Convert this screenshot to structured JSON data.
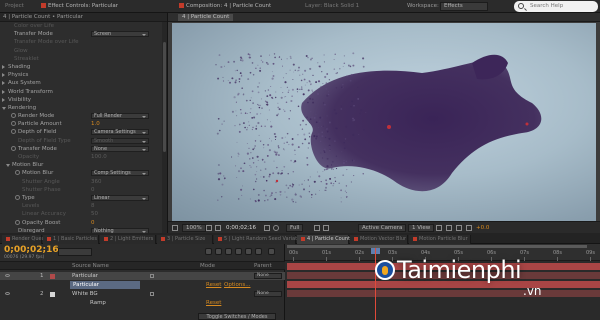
{
  "menubar": {
    "panel1_tab": "Project",
    "effect_controls_tab": "Effect Controls: Particular",
    "composition_tab": "Composition: 4 | Particle Count",
    "layer_tab": "Layer: Black Solid 1",
    "workspace_label": "Workspace:",
    "workspace_value": "Effects",
    "search_placeholder": "Search Help"
  },
  "effect_panel": {
    "header": "4 | Particle Count • Particular",
    "rows": [
      {
        "label": "Color over Life",
        "indent": 14,
        "type": "text",
        "dim": true
      },
      {
        "label": "Transfer Mode",
        "indent": 14,
        "type": "drop",
        "value": "Screen"
      },
      {
        "label": "Transfer Mode over Life",
        "indent": 14,
        "type": "text",
        "dim": true
      },
      {
        "label": "Glow",
        "indent": 14,
        "type": "text",
        "dim": true
      },
      {
        "label": "Streaklet",
        "indent": 14,
        "type": "text",
        "dim": true
      },
      {
        "label": "Shading",
        "indent": 8,
        "type": "section"
      },
      {
        "label": "Physics",
        "indent": 8,
        "type": "section"
      },
      {
        "label": "Aux System",
        "indent": 8,
        "type": "section"
      },
      {
        "label": "World Transform",
        "indent": 8,
        "type": "section"
      },
      {
        "label": "Visibility",
        "indent": 8,
        "type": "section"
      },
      {
        "label": "Rendering",
        "indent": 8,
        "type": "section",
        "open": true
      },
      {
        "label": "Render Mode",
        "indent": 18,
        "type": "drop",
        "value": "Full Render",
        "sw": true
      },
      {
        "label": "Particle Amount",
        "indent": 18,
        "type": "value",
        "value": "1.0",
        "sw": true
      },
      {
        "label": "Depth of Field",
        "indent": 18,
        "type": "drop",
        "value": "Camera Settings",
        "sw": true
      },
      {
        "label": "Depth of Field Type",
        "indent": 18,
        "type": "drop",
        "value": "Smooth",
        "dim": true
      },
      {
        "label": "Transfer Mode",
        "indent": 18,
        "type": "drop",
        "value": "None",
        "sw": true
      },
      {
        "label": "Opacity",
        "indent": 18,
        "type": "value",
        "value": "100.0",
        "dim": true
      },
      {
        "label": "Motion Blur",
        "indent": 12,
        "type": "section",
        "open": true
      },
      {
        "label": "Motion Blur",
        "indent": 22,
        "type": "drop",
        "value": "Comp Settings",
        "sw": true
      },
      {
        "label": "Shutter Angle",
        "indent": 22,
        "type": "value",
        "value": "360",
        "dim": true
      },
      {
        "label": "Shutter Phase",
        "indent": 22,
        "type": "value",
        "value": "0",
        "dim": true
      },
      {
        "label": "Type",
        "indent": 22,
        "type": "drop",
        "value": "Linear",
        "sw": true
      },
      {
        "label": "Levels",
        "indent": 22,
        "type": "value",
        "value": "8",
        "dim": true
      },
      {
        "label": "Linear Accuracy",
        "indent": 22,
        "type": "value",
        "value": "50",
        "dim": true
      },
      {
        "label": "Opacity Boost",
        "indent": 22,
        "type": "value",
        "value": "0",
        "sw": true
      },
      {
        "label": "Disregard",
        "indent": 18,
        "type": "drop",
        "value": "Nothing"
      }
    ]
  },
  "composition": {
    "crumb": "4 | Particle Count",
    "zoom": "100%",
    "timecode": "0;00;02;16",
    "resolution": "Full",
    "camera": "Active Camera",
    "views": "1 View",
    "offset": "+0.0"
  },
  "timeline_tabs": [
    {
      "label": "Render Queue",
      "active": false
    },
    {
      "label": "1 | Basic Particles",
      "active": false
    },
    {
      "label": "2 | Light Emitters",
      "active": false
    },
    {
      "label": "3 | Particle Size",
      "active": false
    },
    {
      "label": "5 | Light Random Seed Variations",
      "active": false
    },
    {
      "label": "4 | Particle Count",
      "active": true
    },
    {
      "label": "Motion Vector Blur",
      "active": false
    },
    {
      "label": "Motion Particle Blur",
      "active": false
    }
  ],
  "timeline": {
    "timecode": "0;00;02;16",
    "frames": "00076 (29.97 fps)",
    "columns": {
      "source": "Source Name",
      "mode": "Mode",
      "parent": "Parent"
    },
    "layers": [
      {
        "num": "1",
        "name": "Particular",
        "color": "#b04a4a",
        "reset": "",
        "options": "",
        "parent": "None",
        "selected": true
      },
      {
        "num": "",
        "name": "Particular",
        "color": "",
        "reset": "Reset",
        "options": "Options...",
        "parent": "",
        "selected": false,
        "editing": true
      },
      {
        "num": "2",
        "name": "White BG",
        "color": "#d6d6d6",
        "reset": "",
        "options": "",
        "parent": "None",
        "selected": false
      },
      {
        "num": "",
        "name": "Ramp",
        "color": "",
        "reset": "Reset",
        "options": "",
        "parent": "",
        "selected": false
      }
    ],
    "toggle_label": "Toggle Switches / Modes",
    "ruler_ticks": [
      "00s",
      "01s",
      "02s",
      "03s",
      "04s",
      "05s",
      "06s",
      "07s",
      "08s",
      "09s"
    ]
  },
  "watermark": {
    "brand": "Taimienphi",
    "suffix": ".vn"
  },
  "colors": {
    "accent_orange": "#e8a226",
    "layer_bar_red": "#b94a4a",
    "particle_purple": "#3b2458",
    "cti_red": "#e04a3a"
  }
}
